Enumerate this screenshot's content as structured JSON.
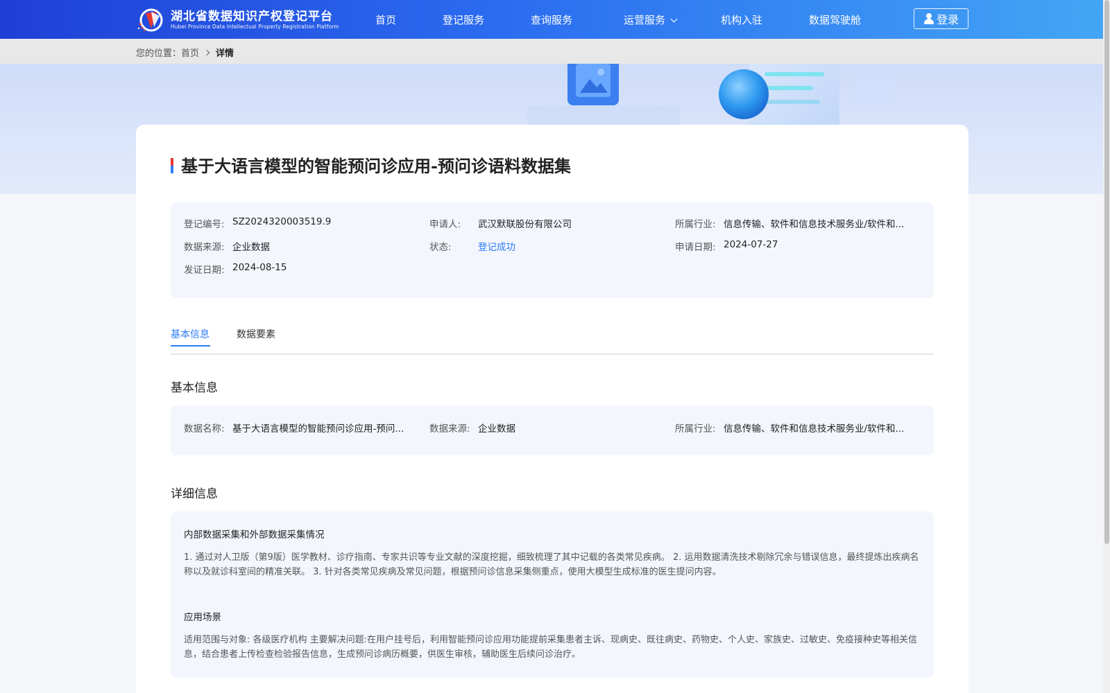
{
  "header": {
    "logo_cn": "湖北省数据知识产权登记平台",
    "logo_en": "Hubei Province Data Intellectual Property Registration Platform",
    "nav": [
      "首页",
      "登记服务",
      "查询服务",
      "运营服务",
      "机构入驻",
      "数据驾驶舱"
    ],
    "login_label": "登录"
  },
  "breadcrumb": {
    "prefix": "您的位置：",
    "home": "首页",
    "current": "详情"
  },
  "detail": {
    "title": "基于大语言模型的智能预问诊应用-预问诊语料数据集",
    "summary": [
      {
        "label": "登记编号:",
        "value": "SZ2024320003519.9"
      },
      {
        "label": "申请人:",
        "value": "武汉默联股份有限公司"
      },
      {
        "label": "所属行业:",
        "value": "信息传输、软件和信息技术服务业/软件和..."
      },
      {
        "label": "数据来源:",
        "value": "企业数据"
      },
      {
        "label": "状态:",
        "value": "登记成功"
      },
      {
        "label": "申请日期:",
        "value": "2024-07-27"
      },
      {
        "label": "发证日期:",
        "value": "2024-08-15"
      }
    ],
    "status_color": "#2d7cf6"
  },
  "tabs": [
    "基本信息",
    "数据要素"
  ],
  "basic_info": {
    "heading": "基本信息",
    "fields": [
      {
        "label": "数据名称:",
        "value": "基于大语言模型的智能预问诊应用-预问..."
      },
      {
        "label": "数据来源:",
        "value": "企业数据"
      },
      {
        "label": "所属行业:",
        "value": "信息传输、软件和信息技术服务业/软件和..."
      }
    ]
  },
  "detail_info": {
    "heading": "详细信息",
    "sections": [
      {
        "title": "内部数据采集和外部数据采集情况",
        "body": "1. 通过对人卫版（第9版）医学教材、诊疗指南、专家共识等专业文献的深度挖掘，细致梳理了其中记载的各类常见疾病。 2. 运用数据清洗技术剔除冗余与错误信息，最终提炼出疾病名称以及就诊科室间的精准关联。 3. 针对各类常见疾病及常见问题，根据预问诊信息采集侧重点，使用大模型生成标准的医生提问内容。"
      },
      {
        "title": "应用场景",
        "body": "适用范围与对象: 各级医疗机构 主要解决问题:在用户挂号后，利用智能预问诊应用功能提前采集患者主诉、现病史、既往病史、药物史、个人史、家族史、过敏史、免疫接种史等相关信息，结合患者上传检查检验报告信息，生成预问诊病历概要，供医生审核，辅助医生后续问诊治疗。"
      }
    ]
  },
  "colors": {
    "header_start": "#1f3fd6",
    "header_end": "#43a6f5",
    "accent": "#2d7cf6"
  }
}
